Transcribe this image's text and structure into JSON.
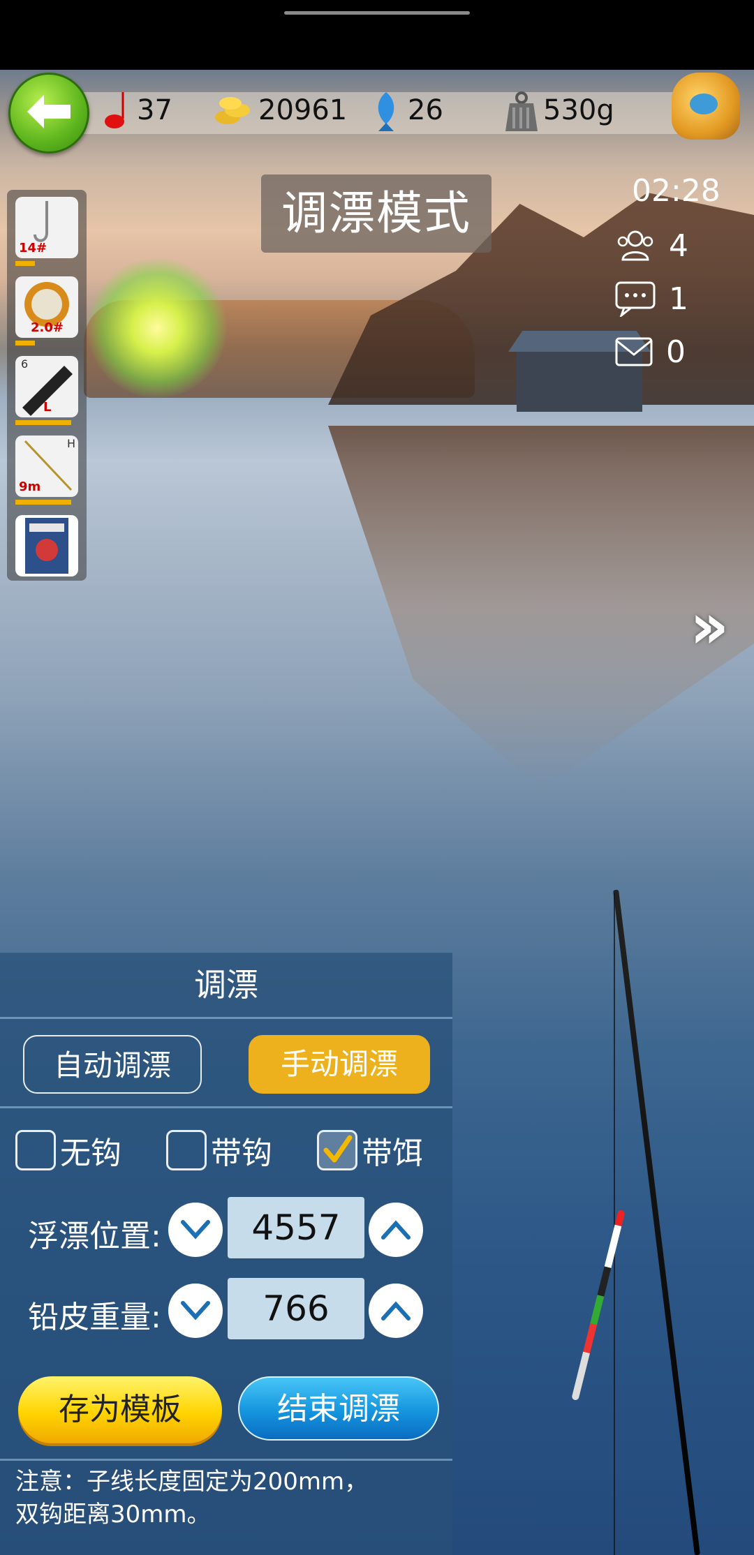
{
  "header": {
    "floats": "37",
    "coins": "20961",
    "fish": "26",
    "weight": "530g"
  },
  "equipment": {
    "hook": "14#",
    "line": "2.0#",
    "rod_number": "6",
    "rod_size": "L",
    "pole_length": "9m",
    "pole_tag": "H"
  },
  "mode_title": "调漂模式",
  "status": {
    "timer": "02:28",
    "players": "4",
    "chat": "1",
    "mail": "0"
  },
  "panel": {
    "title": "调漂",
    "auto_label": "自动调漂",
    "manual_label": "手动调漂",
    "options": [
      {
        "label": "无钩",
        "checked": false
      },
      {
        "label": "带钩",
        "checked": false
      },
      {
        "label": "带饵",
        "checked": true
      }
    ],
    "float_position_label": "浮漂位置:",
    "float_position_value": "4557",
    "sinker_weight_label": "铅皮重量:",
    "sinker_weight_value": "766",
    "save_label": "存为模板",
    "finish_label": "结束调漂",
    "note_line1": "注意：子线长度固定为200mm，",
    "note_line2": "双钩距离30mm。"
  },
  "colors": {
    "accent_yellow": "#eeb11e",
    "accent_blue": "#1495de",
    "back_green": "#5db51d"
  }
}
